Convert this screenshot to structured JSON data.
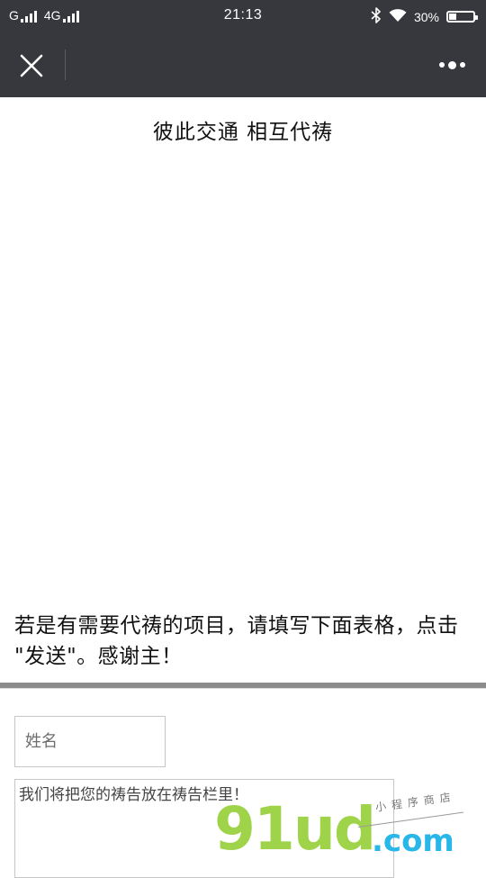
{
  "status_bar": {
    "carrier": "G",
    "network": "4G",
    "time": "21:13",
    "battery_percent": "30%",
    "battery_level": 0.3,
    "icons": [
      "signal-icon",
      "bluetooth-icon",
      "wifi-icon",
      "battery-icon"
    ]
  },
  "nav": {
    "close_icon": "close-icon",
    "more_icon": "more-icon"
  },
  "page": {
    "title": "彼此交通 相互代祷",
    "instructions": "若是有需要代祷的项目，请填写下面表格，点击 \"发送\"。感谢主！"
  },
  "form": {
    "name_placeholder": "姓名",
    "prayer_placeholder": "我们将把您的祷告放在祷告栏里！"
  },
  "watermark": {
    "brand": "91ud",
    "tld": ".com",
    "tagline": "小程序商店"
  },
  "colors": {
    "header_bg": "#37383d",
    "watermark_green": "#9fd34a",
    "watermark_blue": "#29b6e8",
    "divider": "#8c8c8c"
  }
}
